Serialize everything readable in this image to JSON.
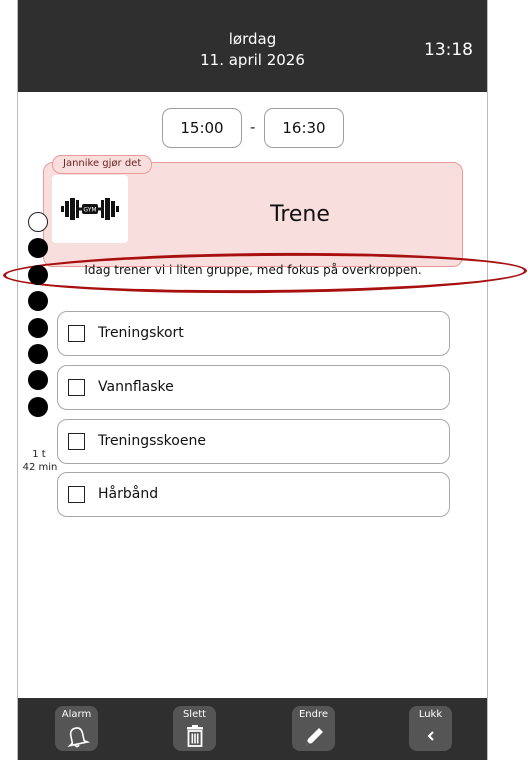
{
  "header": {
    "day": "lørdag",
    "date": "11. april 2026",
    "clock": "13:18"
  },
  "time_range": {
    "start": "15:00",
    "separator": "-",
    "end": "16:30"
  },
  "activity": {
    "assignee": "Jannike gjør det",
    "icon": "gym-dumbbell-icon",
    "icon_text": "GYM",
    "title": "Trene",
    "description": "Idag trener vi i liten gruppe, med fokus på overkroppen."
  },
  "progress": {
    "total_dots": 8,
    "elapsed_dots": 7,
    "remaining_hours": "1 t",
    "remaining_minutes": "42 min"
  },
  "checklist": [
    {
      "label": "Treningskort",
      "checked": false
    },
    {
      "label": "Vannflaske",
      "checked": false
    },
    {
      "label": "Treningsskoene",
      "checked": false
    },
    {
      "label": "Hårbånd",
      "checked": false
    }
  ],
  "toolbar": {
    "alarm": "Alarm",
    "delete": "Slett",
    "edit": "Endre",
    "close": "Lukk"
  },
  "colors": {
    "header_bg": "#2f2f2f",
    "card_bg": "#f9dede",
    "card_border": "#e89a9a",
    "highlight": "#a80f0f"
  }
}
